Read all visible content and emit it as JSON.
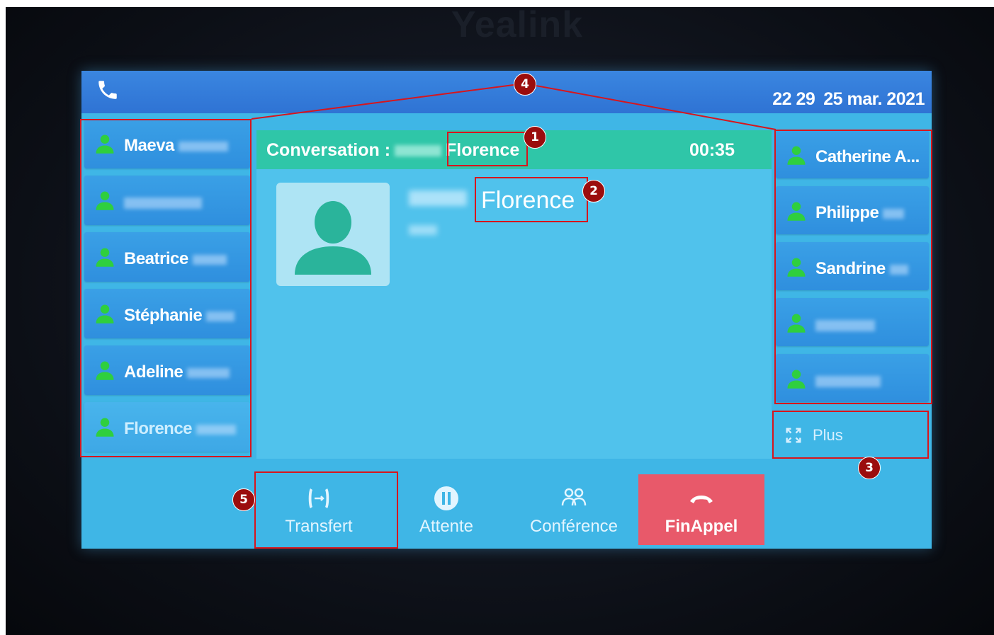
{
  "device": {
    "brand": "Yealink"
  },
  "status_bar": {
    "time": "22 29",
    "date": "25 mar. 2021"
  },
  "left_contacts": [
    {
      "name": "Maeva",
      "blurred_suffix": true
    },
    {
      "name": "",
      "blurred_suffix": true
    },
    {
      "name": "Beatrice",
      "blurred_suffix": true
    },
    {
      "name": "Stéphanie",
      "blurred_suffix": true
    },
    {
      "name": "Adeline",
      "blurred_suffix": true
    },
    {
      "name": "Florence",
      "blurred_suffix": true
    }
  ],
  "right_contacts": [
    {
      "name": "Catherine A..."
    },
    {
      "name": "Philippe",
      "blurred_suffix": true
    },
    {
      "name": "Sandrine",
      "blurred_suffix": true
    },
    {
      "name": "",
      "blurred_suffix": true
    },
    {
      "name": "",
      "blurred_suffix": true
    }
  ],
  "more_button": {
    "label": "Plus"
  },
  "conversation": {
    "prefix": "Conversation :",
    "first_name": "Florence",
    "timer": "00:35",
    "caller_first_name": "Florence"
  },
  "softkeys": {
    "transfer": "Transfert",
    "hold": "Attente",
    "conference": "Conférence",
    "end_call": "FinAppel"
  },
  "annotations": [
    "1",
    "2",
    "3",
    "4",
    "5"
  ],
  "colors": {
    "status_bar": "#2f73d4",
    "screen_bg": "#3fb6e6",
    "contact_bg": "#2f8fde",
    "header_green": "#2fc6a8",
    "presence_green": "#2fcf3e",
    "end_call_red": "#e8596a",
    "annotation_red": "#d8151c"
  },
  "icons": {
    "status": "phone-handset-icon",
    "contact": "person-presence-icon",
    "more": "expand-arrows-icon",
    "transfer": "call-transfer-icon",
    "hold": "pause-icon",
    "conference": "conference-people-icon",
    "end_call": "hang-up-icon"
  }
}
